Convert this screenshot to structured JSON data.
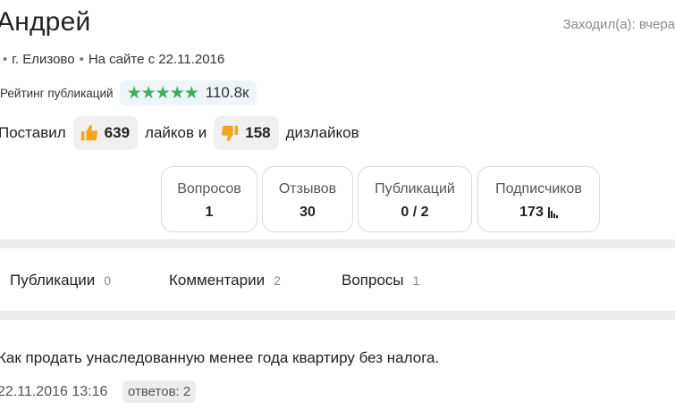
{
  "profile": {
    "name": "Андрей",
    "last_seen": "Заходил(а): вчера",
    "meta": {
      "bullet": "•",
      "city": "г. Елизово",
      "since": "На сайте с 22.11.2016"
    }
  },
  "rating": {
    "label": "Рейтинг публикаций",
    "stars": "★★★★★",
    "star_count": 5,
    "value": "110.8к"
  },
  "likes": {
    "prefix": "Поставил",
    "likes_count": "639",
    "middle": "лайков и",
    "dislikes_count": "158",
    "suffix": "дизлайков"
  },
  "stats": [
    {
      "label": "Вопросов",
      "value": "1"
    },
    {
      "label": "Отзывов",
      "value": "30"
    },
    {
      "label": "Публикаций",
      "value": "0 / 2"
    },
    {
      "label": "Подписчиков",
      "value": "173"
    }
  ],
  "tabs": [
    {
      "label": "Публикации",
      "count": "0"
    },
    {
      "label": "Комментарии",
      "count": "2"
    },
    {
      "label": "Вопросы",
      "count": "1"
    }
  ],
  "publication": {
    "title": "Как продать унаследованную менее года квартиру без налога.",
    "date": "22.11.2016 13:16",
    "answers": "ответов: 2"
  },
  "colors": {
    "star": "#3fae5f",
    "thumb": "#f2a51f",
    "divider": "#ececec",
    "rating_bg": "#eef5f9"
  },
  "icons": {
    "like": "thumbs-up-icon",
    "dislike": "thumbs-down-icon",
    "chart": "bar-chart-icon"
  }
}
